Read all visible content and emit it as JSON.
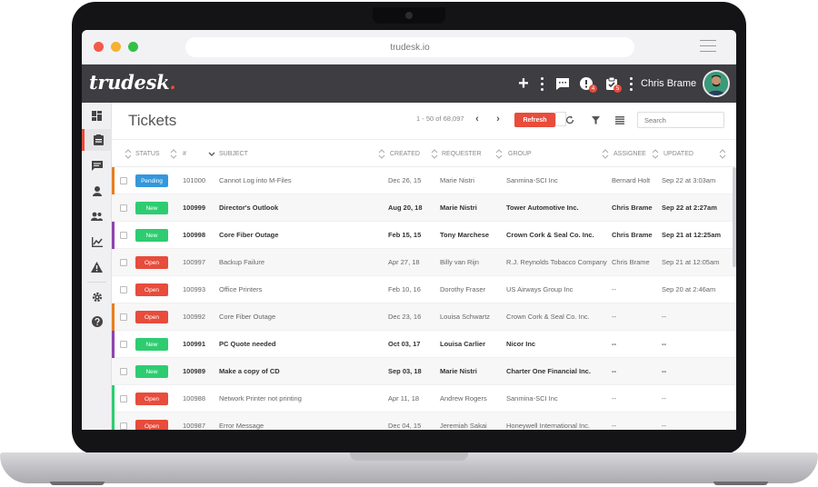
{
  "browser": {
    "url": "trudesk.io"
  },
  "app": {
    "logo": "trudesk",
    "logo_dot": ".",
    "user_name": "Chris Brame",
    "notifications_badge": "4",
    "tasks_badge": "5"
  },
  "icons": {
    "plus": "+",
    "prev": "‹",
    "next": "›"
  },
  "toolbar": {
    "title": "Tickets",
    "pagination": "1 - 50 of 68,097",
    "refresh_label": "Refresh",
    "search_placeholder": "Search"
  },
  "colors": {
    "accent": "#e74c3c",
    "topbar": "#3d3d42",
    "pending": "#3498db",
    "new": "#2ecc71",
    "open": "#e74c3c"
  },
  "table": {
    "headers": {
      "status": "STATUS",
      "num": "#",
      "subject": "SUBJECT",
      "created": "CREATED",
      "requester": "REQUESTER",
      "group": "GROUP",
      "assignee": "ASSIGNEE",
      "updated": "UPDATED"
    },
    "rows": [
      {
        "status": "Pending",
        "num": "101000",
        "subject": "Cannot Log into M-Files",
        "created": "Dec 26, 15",
        "requester": "Marie Nistri",
        "group": "Sanmina-SCI Inc",
        "assignee": "Bernard Holt",
        "updated": "Sep 22 at 3:03am"
      },
      {
        "status": "New",
        "num": "100999",
        "subject": "Director's Outlook",
        "created": "Aug 20, 18",
        "requester": "Marie Nistri",
        "group": "Tower Automotive Inc.",
        "assignee": "Chris Brame",
        "updated": "Sep 22 at 2:27am"
      },
      {
        "status": "New",
        "num": "100998",
        "subject": "Core Fiber Outage",
        "created": "Feb 15, 15",
        "requester": "Tony Marchese",
        "group": "Crown Cork & Seal Co. Inc.",
        "assignee": "Chris Brame",
        "updated": "Sep 21 at 12:25am"
      },
      {
        "status": "Open",
        "num": "100997",
        "subject": "Backup Failure",
        "created": "Apr 27, 18",
        "requester": "Billy van Rijn",
        "group": "R.J. Reynolds Tobacco Company",
        "assignee": "Chris Brame",
        "updated": "Sep 21 at 12:05am"
      },
      {
        "status": "Open",
        "num": "100993",
        "subject": "Office Printers",
        "created": "Feb 10, 16",
        "requester": "Dorothy Fraser",
        "group": "US Airways Group Inc",
        "assignee": "--",
        "updated": "Sep 20 at 2:46am"
      },
      {
        "status": "Open",
        "num": "100992",
        "subject": "Core Fiber Outage",
        "created": "Dec 23, 16",
        "requester": "Louisa Schwartz",
        "group": "Crown Cork & Seal Co. Inc.",
        "assignee": "--",
        "updated": "--"
      },
      {
        "status": "New",
        "num": "100991",
        "subject": "PC Quote needed",
        "created": "Oct 03, 17",
        "requester": "Louisa Carlier",
        "group": "Nicor Inc",
        "assignee": "--",
        "updated": "--"
      },
      {
        "status": "New",
        "num": "100989",
        "subject": "Make a copy of CD",
        "created": "Sep 03, 18",
        "requester": "Marie Nistri",
        "group": "Charter One Financial Inc.",
        "assignee": "--",
        "updated": "--"
      },
      {
        "status": "Open",
        "num": "100988",
        "subject": "Network Printer not printing",
        "created": "Apr 11, 18",
        "requester": "Andrew Rogers",
        "group": "Sanmina-SCI Inc",
        "assignee": "--",
        "updated": "--"
      },
      {
        "status": "Open",
        "num": "100987",
        "subject": "Error Message",
        "created": "Dec 04, 15",
        "requester": "Jeremiah Sakai",
        "group": "Honeywell International Inc.",
        "assignee": "--",
        "updated": "--"
      }
    ]
  }
}
